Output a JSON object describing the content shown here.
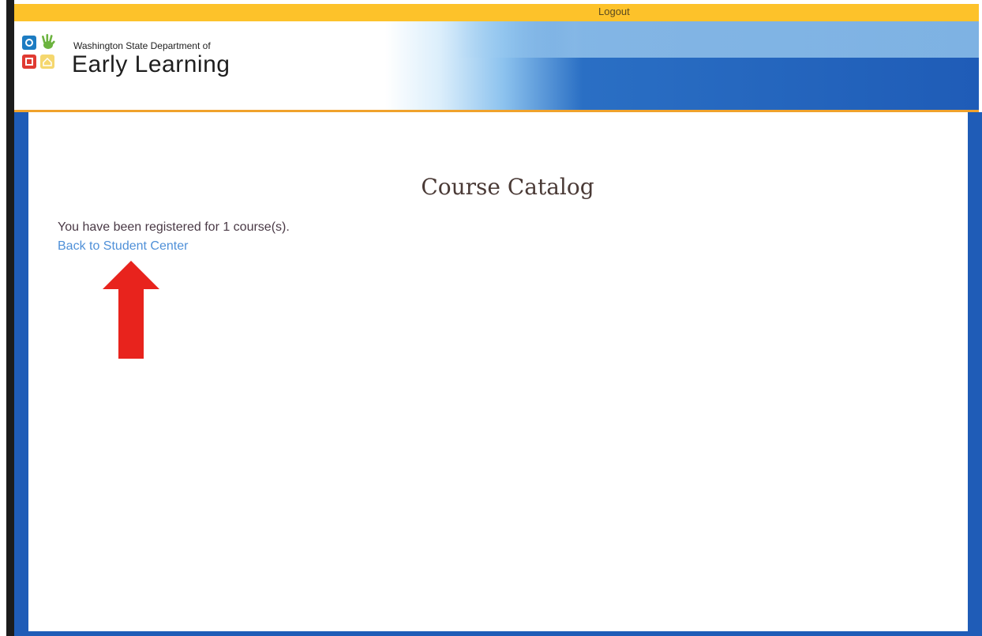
{
  "topbar": {
    "logout_label": "Logout"
  },
  "header": {
    "agency_line": "Washington State Department of",
    "agency_name": "Early Learning",
    "colors": {
      "topbar": "#fdc22a",
      "accent_line": "#f0a22c",
      "blue": "#1f5cb7"
    }
  },
  "logo": {
    "icons": [
      "circle-square-icon",
      "hand-icon",
      "square-icon",
      "house-icon"
    ]
  },
  "main": {
    "title": "Course Catalog",
    "message": "You have been registered for 1 course(s).",
    "back_link_label": "Back to Student Center",
    "annotation_arrow_color": "#e8231d"
  }
}
